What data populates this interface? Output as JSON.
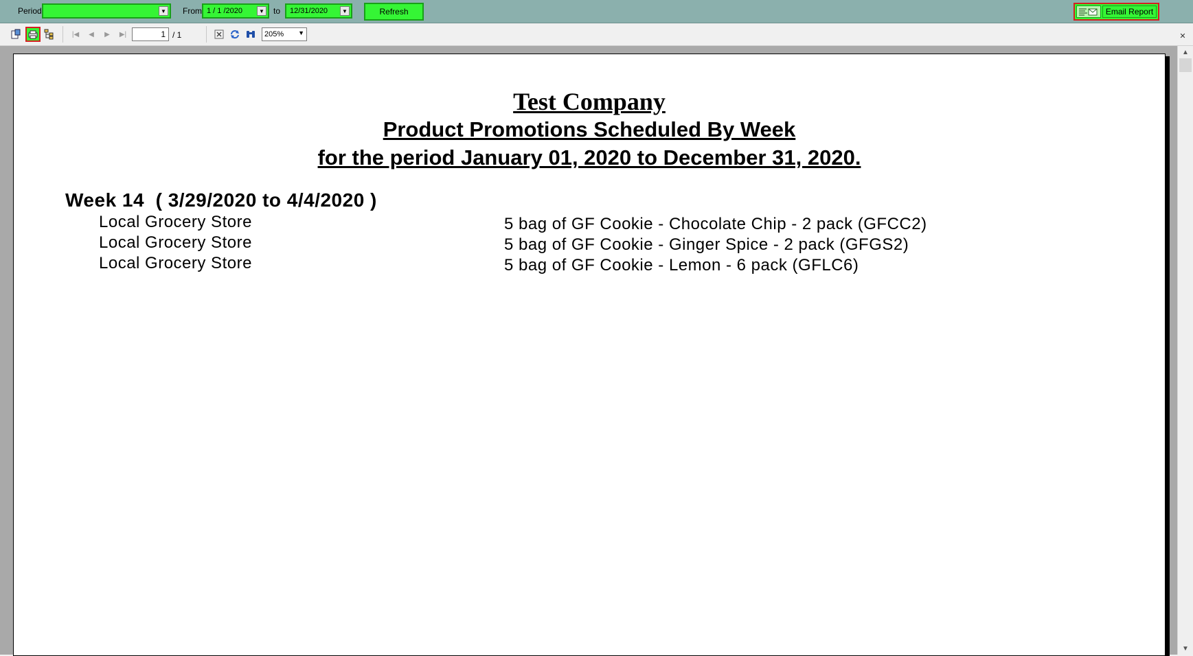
{
  "filter_bar": {
    "period_label": "Period",
    "period_value": "",
    "from_label": "From",
    "from_value": "1 / 1 /2020",
    "to_label": "to",
    "to_value": "12/31/2020",
    "refresh_label": "Refresh",
    "email_label": "Email Report"
  },
  "toolbar": {
    "current_page": "1",
    "total_pages": "/ 1",
    "zoom": "205%"
  },
  "report": {
    "company": "Test Company",
    "title": "Product Promotions Scheduled By Week",
    "period": "for the period January 01, 2020 to December 31, 2020.",
    "week_header": "Week 14  ( 3/29/2020 to 4/4/2020 )",
    "rows": [
      {
        "store": "Local Grocery Store",
        "product": "5 bag of GF Cookie - Chocolate Chip - 2 pack (GFCC2)"
      },
      {
        "store": "Local Grocery Store",
        "product": "5 bag of GF Cookie - Ginger Spice - 2 pack (GFGS2)"
      },
      {
        "store": "Local Grocery Store",
        "product": "5 bag of GF Cookie - Lemon - 6 pack (GFLC6)"
      }
    ]
  },
  "colors": {
    "top_bar": "#8bb0ad",
    "green_field": "#35f535",
    "highlight_border": "#d42020",
    "viewer_bg": "#a9a9a9"
  }
}
